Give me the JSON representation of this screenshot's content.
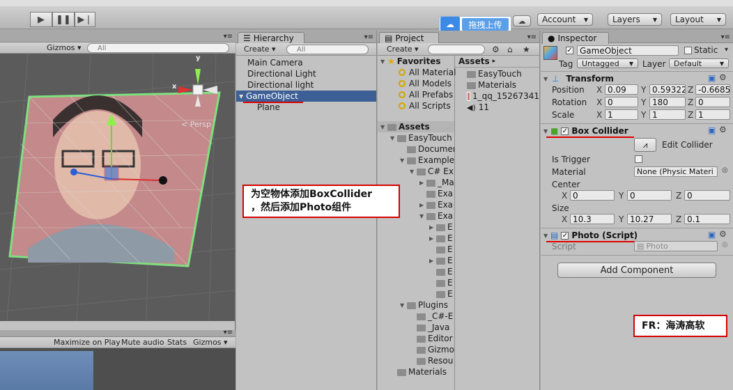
{
  "toolbar": {
    "play_icon": "play-icon",
    "pause_icon": "pause-icon",
    "step_icon": "step-icon",
    "account": "Account",
    "layers": "Layers",
    "layout": "Layout",
    "cloud_icon": "cloud-icon",
    "upload": "拖拽上传"
  },
  "scene": {
    "gizmos": "Gizmos",
    "search_ph": "All",
    "persp": "Persp",
    "axis_y": "y",
    "axis_x": "x"
  },
  "game": {
    "maximize": "Maximize on Play",
    "mute": "Mute audio",
    "stats": "Stats",
    "gizmos": "Gizmos"
  },
  "hierarchy": {
    "tab": "Hierarchy",
    "create": "Create",
    "search_ph": "All",
    "items": [
      "Main Camera",
      "Directional Light",
      "Directional light",
      "GameObject",
      "Plane"
    ]
  },
  "project": {
    "tab": "Project",
    "create": "Create",
    "favorites": "Favorites",
    "fav_items": [
      "All Material",
      "All Models",
      "All Prefabs",
      "All Scripts"
    ],
    "assets_header": "Assets",
    "tree": [
      "EasyTouch",
      "Documen",
      "Example",
      "C# Ex",
      "_Ma",
      "Exa",
      "Exa",
      "Exa",
      "E",
      "E",
      "E",
      "E",
      "E",
      "E",
      "E",
      "Plugins",
      "_C#-E",
      "_Java",
      "Editor",
      "Gizmo",
      "Resou",
      "Materials"
    ],
    "assets_breadcrumb": "Assets",
    "right_items": [
      "EasyTouch",
      "Materials",
      "1_qq_15267341",
      "11"
    ]
  },
  "inspector": {
    "tab": "Inspector",
    "name": "GameObject",
    "static_label": "Static",
    "tag_label": "Tag",
    "tag_value": "Untagged",
    "layer_label": "Layer",
    "layer_value": "Default",
    "transform": "Transform",
    "position": {
      "label": "Position",
      "x": "0.09",
      "y": "0.59322",
      "z": "-0.6685"
    },
    "rotation": {
      "label": "Rotation",
      "x": "0",
      "y": "180",
      "z": "0"
    },
    "scale": {
      "label": "Scale",
      "x": "1",
      "y": "1",
      "z": "1"
    },
    "box_collider": "Box Collider",
    "edit_collider": "Edit Collider",
    "is_trigger": "Is Trigger",
    "material_label": "Material",
    "material_value": "None (Physic Materi",
    "center": {
      "label": "Center",
      "x": "0",
      "y": "0",
      "z": "0"
    },
    "size": {
      "label": "Size",
      "x": "10.3",
      "y": "10.27",
      "z": "0.1"
    },
    "photo_script": "Photo (Script)",
    "script_label": "Script",
    "script_value": "Photo",
    "add_component": "Add Component"
  },
  "annotations": {
    "note1_line1": "为空物体添加BoxCollider",
    "note1_line2": "，然后添加Photo组件",
    "note2": "FR：海涛高软"
  },
  "colors": {
    "selection": "#3c5f96",
    "callout_border": "#d40000",
    "panel": "#c2c2c2",
    "scene_bg": "#5a5a5a"
  }
}
